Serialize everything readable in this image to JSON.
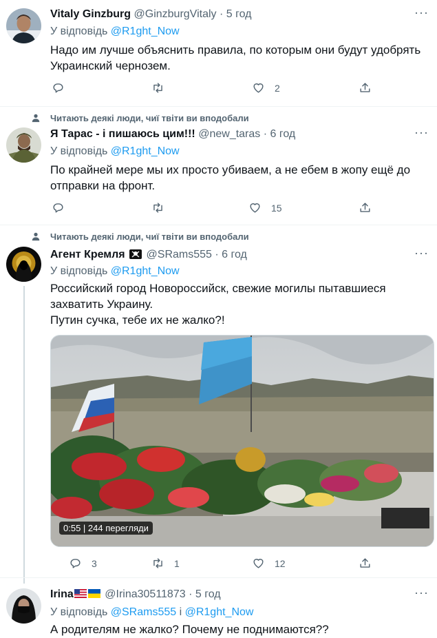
{
  "tweets": [
    {
      "name": "Vitaly Ginzburg",
      "handle": "@GinzburgVitaly",
      "dot": "·",
      "time": "5 год",
      "reply_prefix": "У відповідь",
      "reply_to": "@R1ght_Now",
      "text": "Надо им лучше объяснить правила, по которым они будут удобрять Украинский чернозем.",
      "replies": "",
      "retweets": "",
      "likes": "2"
    },
    {
      "social_context": "Читають деякі люди, чиї твіти ви вподобали",
      "name": "Я Тарас - і пишаюсь цим!!!",
      "handle": "@new_taras",
      "dot": "·",
      "time": "6 год",
      "reply_prefix": "У відповідь",
      "reply_to": "@R1ght_Now",
      "text": "По крайней мере мы их просто убиваем, а не ебем в жопу ещё до отправки на фронт.",
      "replies": "",
      "retweets": "",
      "likes": "15"
    },
    {
      "social_context": "Читають деякі люди, чиї твіти ви вподобали",
      "name": "Агент Кремля",
      "handle": "@SRams555",
      "dot": "·",
      "time": "6 год",
      "reply_prefix": "У відповідь",
      "reply_to": "@R1ght_Now",
      "text": "Российский город Новороссийск, свежие могилы пытавшиеся захватить Украину.\nПутин сучка, тебе их не жалко?!",
      "video_badge": "0:55 | 244 перегляди",
      "replies": "3",
      "retweets": "1",
      "likes": "12"
    },
    {
      "name": "Irina",
      "handle": "@Irina30511873",
      "dot": "·",
      "time": "5 год",
      "reply_prefix": "У відповідь",
      "reply_to": "@SRams555",
      "reply_and": "і",
      "reply_to2": "@R1ght_Now",
      "text": "А родителям не жалко? Почему не поднимаются??"
    }
  ],
  "icons": {
    "reply": "reply-icon",
    "retweet": "retweet-icon",
    "like": "heart-icon",
    "share": "share-icon",
    "more": "more-icon"
  },
  "colors": {
    "link": "#1d9bf0",
    "secondary": "#536471",
    "text": "#0f1419",
    "separator": "#eff3f4"
  }
}
